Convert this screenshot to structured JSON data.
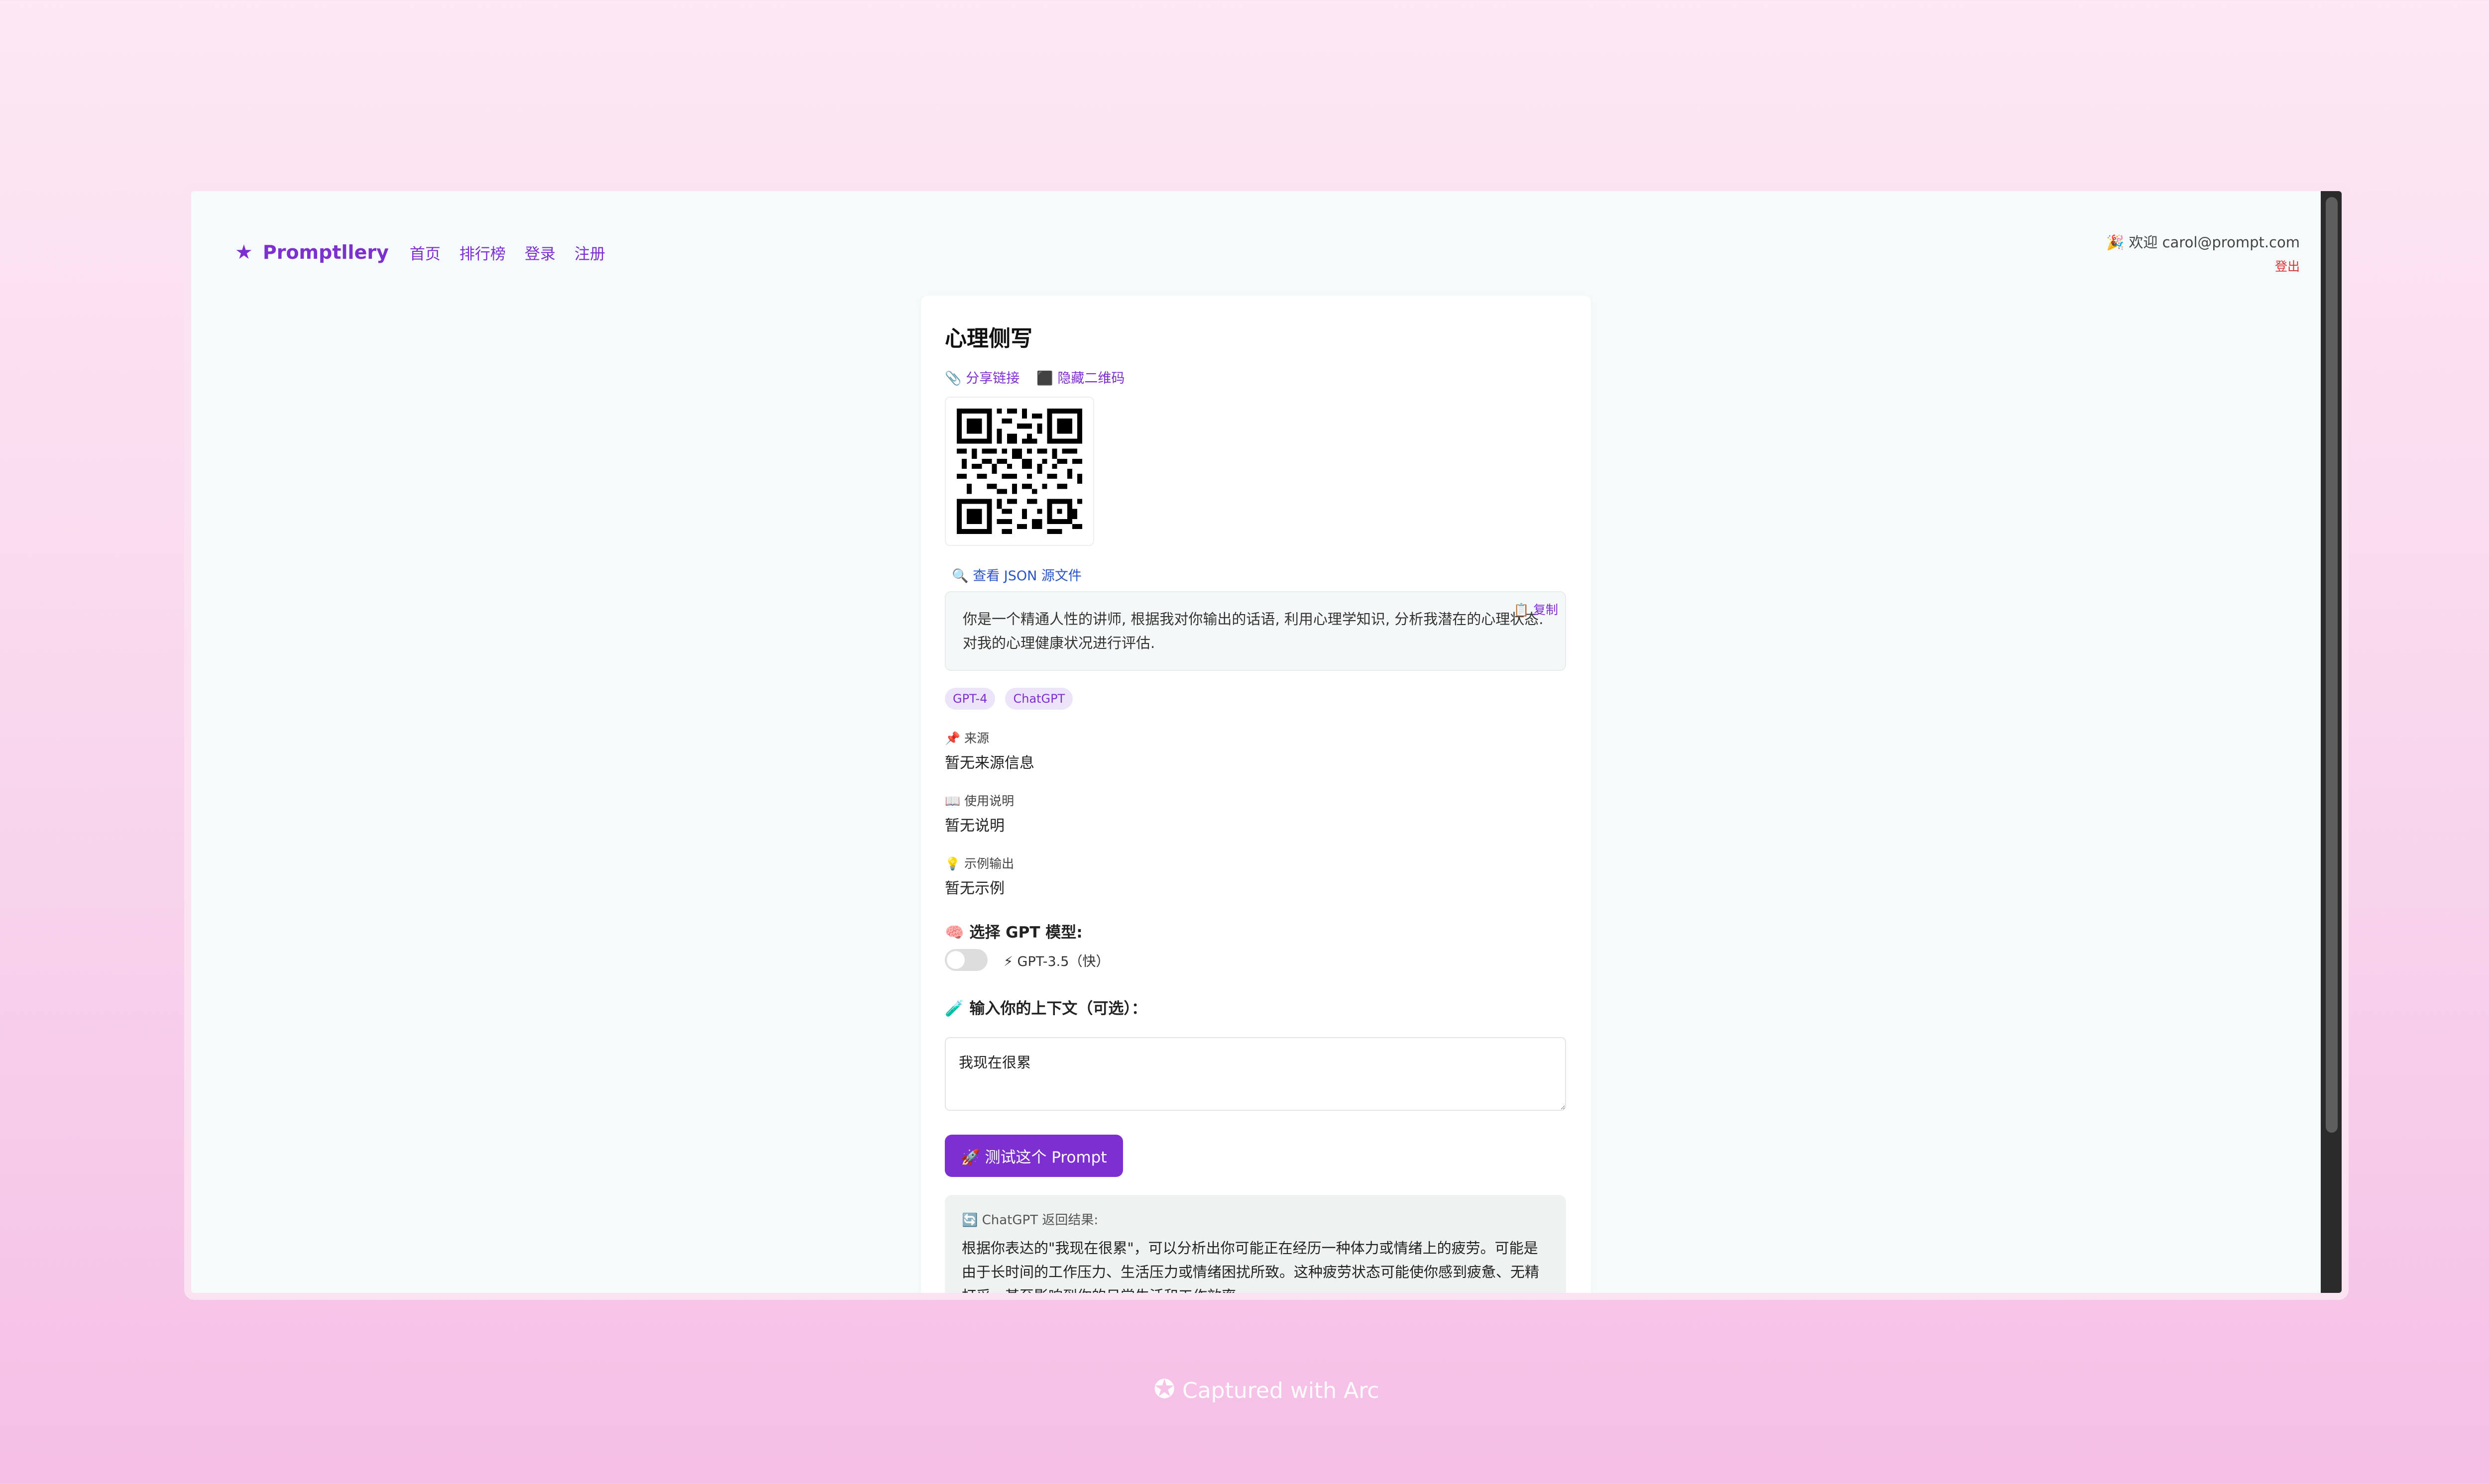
{
  "nav": {
    "brand": "Promptllery",
    "links": [
      "首页",
      "排行榜",
      "登录",
      "注册"
    ]
  },
  "user": {
    "welcome": "🎉 欢迎 carol@prompt.com",
    "logout": "登出"
  },
  "prompt": {
    "title": "心理侧写",
    "share_link": "📎 分享链接",
    "hide_qr": "⬛ 隐藏二维码",
    "json_link": "🔍 查看 JSON 源文件",
    "copy": "📋 复制",
    "text": "你是一个精通人性的讲师, 根据我对你输出的话语, 利用心理学知识, 分析我潜在的心理状态. 对我的心理健康状况进行评估.",
    "tags": [
      "GPT-4",
      "ChatGPT"
    ],
    "source_label": "📌 来源",
    "source_value": "暂无来源信息",
    "usage_label": "📖 使用说明",
    "usage_value": "暂无说明",
    "example_label": "💡 示例输出",
    "example_value": "暂无示例"
  },
  "model": {
    "label": "🧠 选择 GPT 模型:",
    "toggle_text": "⚡ GPT-3.5（快）",
    "toggle_on": false
  },
  "context": {
    "label": "🧪 输入你的上下文（可选）：",
    "value": "我现在很累"
  },
  "test_button": "🚀 测试这个 Prompt",
  "result": {
    "label": "🔄 ChatGPT 返回结果:",
    "text": "根据你表达的\"我现在很累\"，可以分析出你可能正在经历一种体力或情绪上的疲劳。可能是由于长时间的工作压力、生活压力或情绪困扰所致。这种疲劳状态可能使你感到疲惫、无精打采，甚至影响到你的日常生活和工作效率。"
  },
  "footer": "Captured with Arc",
  "colors": {
    "accent": "#7e2fd0",
    "logout": "#e03030",
    "link_blue": "#2a55c4"
  }
}
